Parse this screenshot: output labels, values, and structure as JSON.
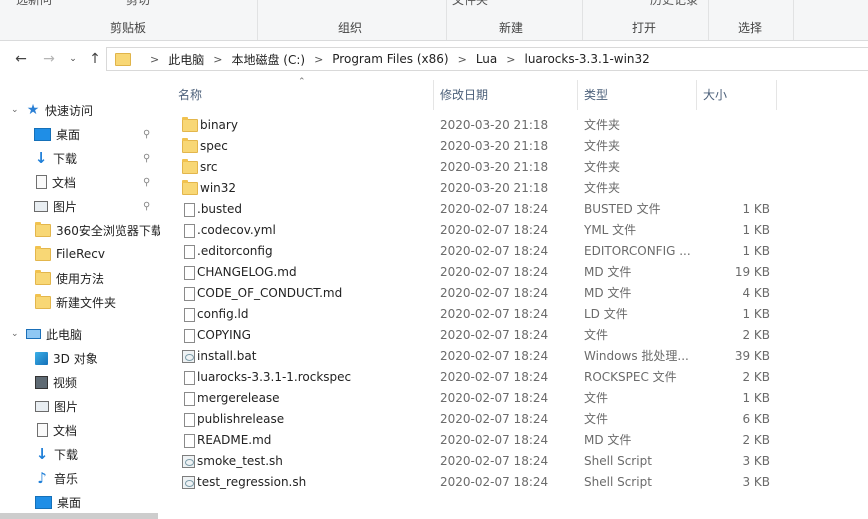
{
  "ribbon": {
    "top_clipped": [
      "选新问",
      "剪切",
      "文件夹",
      "历史记录"
    ],
    "groups": [
      "剪贴板",
      "组织",
      "新建",
      "打开",
      "选择"
    ]
  },
  "address": {
    "crumbs": [
      "此电脑",
      "本地磁盘 (C:)",
      "Program Files (x86)",
      "Lua",
      "luarocks-3.3.1-win32"
    ]
  },
  "nav": {
    "quick_access": "快速访问",
    "quick_items": [
      {
        "label": "桌面",
        "icon": "desktop-icon",
        "pinned": true
      },
      {
        "label": "下载",
        "icon": "download-icon",
        "pinned": true
      },
      {
        "label": "文档",
        "icon": "documents-icon",
        "pinned": true
      },
      {
        "label": "图片",
        "icon": "pictures-icon",
        "pinned": true
      },
      {
        "label": "360安全浏览器下载",
        "icon": "folder-icon",
        "pinned": false
      },
      {
        "label": "FileRecv",
        "icon": "folder-icon",
        "pinned": false
      },
      {
        "label": "使用方法",
        "icon": "folder-icon",
        "pinned": false
      },
      {
        "label": "新建文件夹",
        "icon": "folder-icon",
        "pinned": false
      }
    ],
    "this_pc": "此电脑",
    "pc_items": [
      {
        "label": "3D 对象",
        "icon": "3d-objects-icon"
      },
      {
        "label": "视频",
        "icon": "video-icon"
      },
      {
        "label": "图片",
        "icon": "pictures-icon"
      },
      {
        "label": "文档",
        "icon": "documents-icon"
      },
      {
        "label": "下载",
        "icon": "download-icon"
      },
      {
        "label": "音乐",
        "icon": "music-icon"
      },
      {
        "label": "桌面",
        "icon": "desktop-icon"
      }
    ]
  },
  "columns": {
    "name": "名称",
    "date": "修改日期",
    "type": "类型",
    "size": "大小"
  },
  "files": [
    {
      "name": "binary",
      "date": "2020-03-20 21:18",
      "type": "文件夹",
      "size": "",
      "icon": "folder"
    },
    {
      "name": "spec",
      "date": "2020-03-20 21:18",
      "type": "文件夹",
      "size": "",
      "icon": "folder"
    },
    {
      "name": "src",
      "date": "2020-03-20 21:18",
      "type": "文件夹",
      "size": "",
      "icon": "folder"
    },
    {
      "name": "win32",
      "date": "2020-03-20 21:18",
      "type": "文件夹",
      "size": "",
      "icon": "folder"
    },
    {
      "name": ".busted",
      "date": "2020-02-07 18:24",
      "type": "BUSTED 文件",
      "size": "1 KB",
      "icon": "file"
    },
    {
      "name": ".codecov.yml",
      "date": "2020-02-07 18:24",
      "type": "YML 文件",
      "size": "1 KB",
      "icon": "file"
    },
    {
      "name": ".editorconfig",
      "date": "2020-02-07 18:24",
      "type": "EDITORCONFIG ...",
      "size": "1 KB",
      "icon": "file"
    },
    {
      "name": "CHANGELOG.md",
      "date": "2020-02-07 18:24",
      "type": "MD 文件",
      "size": "19 KB",
      "icon": "file"
    },
    {
      "name": "CODE_OF_CONDUCT.md",
      "date": "2020-02-07 18:24",
      "type": "MD 文件",
      "size": "4 KB",
      "icon": "file"
    },
    {
      "name": "config.ld",
      "date": "2020-02-07 18:24",
      "type": "LD 文件",
      "size": "1 KB",
      "icon": "file"
    },
    {
      "name": "COPYING",
      "date": "2020-02-07 18:24",
      "type": "文件",
      "size": "2 KB",
      "icon": "file"
    },
    {
      "name": "install.bat",
      "date": "2020-02-07 18:24",
      "type": "Windows 批处理...",
      "size": "39 KB",
      "icon": "script"
    },
    {
      "name": "luarocks-3.3.1-1.rockspec",
      "date": "2020-02-07 18:24",
      "type": "ROCKSPEC 文件",
      "size": "2 KB",
      "icon": "file"
    },
    {
      "name": "mergerelease",
      "date": "2020-02-07 18:24",
      "type": "文件",
      "size": "1 KB",
      "icon": "file"
    },
    {
      "name": "publishrelease",
      "date": "2020-02-07 18:24",
      "type": "文件",
      "size": "6 KB",
      "icon": "file"
    },
    {
      "name": "README.md",
      "date": "2020-02-07 18:24",
      "type": "MD 文件",
      "size": "2 KB",
      "icon": "file"
    },
    {
      "name": "smoke_test.sh",
      "date": "2020-02-07 18:24",
      "type": "Shell Script",
      "size": "3 KB",
      "icon": "script"
    },
    {
      "name": "test_regression.sh",
      "date": "2020-02-07 18:24",
      "type": "Shell Script",
      "size": "3 KB",
      "icon": "script"
    }
  ]
}
